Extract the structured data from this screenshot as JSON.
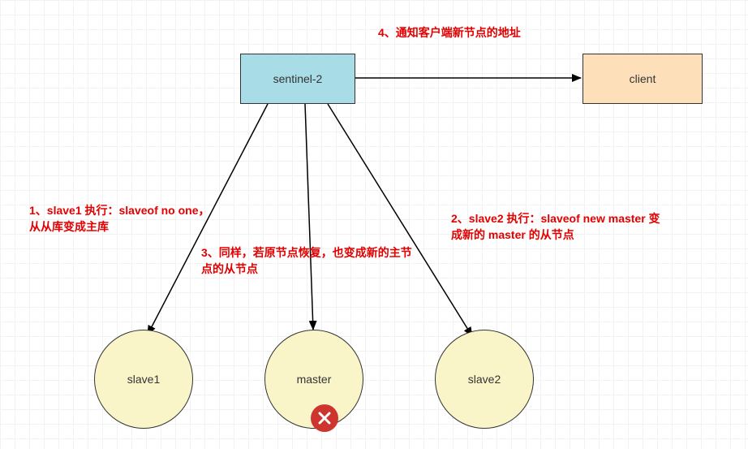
{
  "nodes": {
    "sentinel": "sentinel-2",
    "client": "client",
    "slave1": "slave1",
    "master": "master",
    "slave2": "slave2"
  },
  "annotations": {
    "a1": "1、slave1 执行：slaveof no one，从从库变成主库",
    "a2": "2、slave2 执行：slaveof new master 变成新的 master 的从节点",
    "a3": "3、同样，若原节点恢复，也变成新的主节点的从节点",
    "a4": "4、通知客户端新节点的地址"
  },
  "icons": {
    "fail": "close-icon"
  }
}
